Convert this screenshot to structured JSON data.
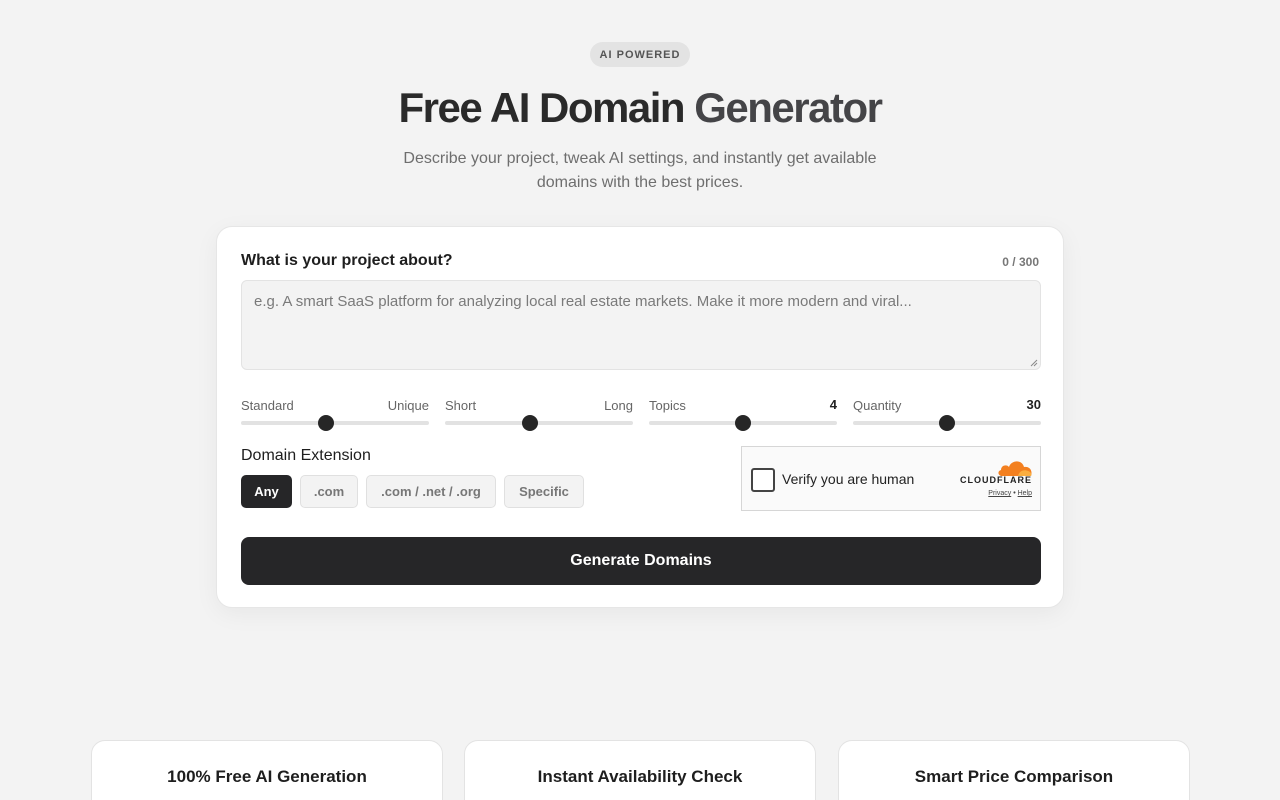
{
  "hero": {
    "badge": "AI POWERED",
    "title_part1": "Free AI Domain ",
    "title_part2": "Generator",
    "subtitle": "Describe your project, tweak AI settings, and instantly get available domains with the best prices."
  },
  "form": {
    "question_label": "What is your project about?",
    "char_counter": "0 / 300",
    "textarea_placeholder": "e.g. A smart SaaS platform for analyzing local real estate markets. Make it more modern and viral...",
    "sliders": [
      {
        "left_label": "Standard",
        "right_label": "Unique",
        "value_fraction": 0.45
      },
      {
        "left_label": "Short",
        "right_label": "Long",
        "value_fraction": 0.45
      },
      {
        "left_label": "Topics",
        "value": "4",
        "value_fraction": 0.5
      },
      {
        "left_label": "Quantity",
        "value": "30",
        "value_fraction": 0.5
      }
    ],
    "extension_label": "Domain Extension",
    "extension_options": [
      ".com"
    ],
    "extension_any": "Any",
    "extension_com": ".com",
    "extension_trio": ".com / .net / .org",
    "extension_specific": "Specific",
    "selected_extension": "Any",
    "captcha": {
      "text": "Verify you are human",
      "brand": "CLOUDFLARE",
      "privacy": "Privacy",
      "separator": "•",
      "help": "Help"
    },
    "generate_label": "Generate Domains"
  },
  "features": [
    {
      "title": "100% Free AI Generation"
    },
    {
      "title": "Instant Availability Check"
    },
    {
      "title": "Smart Price Comparison"
    }
  ],
  "colors": {
    "accent_dark": "#262628",
    "cloudflare_orange": "#f38020"
  }
}
